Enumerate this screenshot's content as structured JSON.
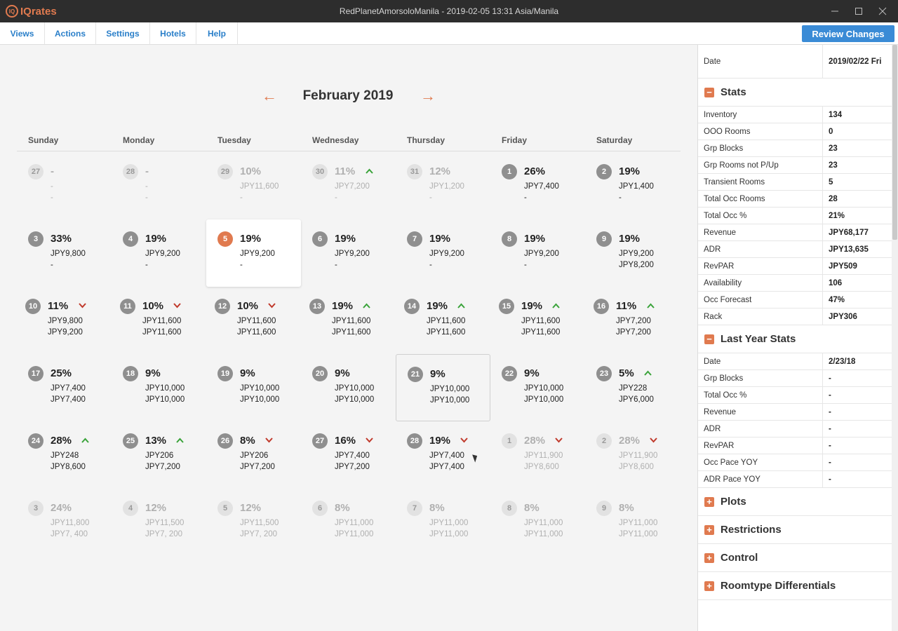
{
  "app": {
    "logo_text": "IQrates",
    "logo_mark": "IQ",
    "window_title": "RedPlanetAmorsoloManila - 2019-02-05 13:31 Asia/Manila"
  },
  "menu": {
    "items": [
      "Views",
      "Actions",
      "Settings",
      "Hotels",
      "Help"
    ],
    "review_label": "Review Changes"
  },
  "calendar": {
    "month": "February 2019",
    "prev_icon": "←",
    "next_icon": "→",
    "weekdays": [
      "Sunday",
      "Monday",
      "Tuesday",
      "Wednesday",
      "Thursday",
      "Friday",
      "Saturday"
    ],
    "weeks": [
      [
        {
          "day": "27",
          "occ": "-",
          "l1": "-",
          "l2": "-",
          "muted": true
        },
        {
          "day": "28",
          "occ": "-",
          "l1": "-",
          "l2": "-",
          "muted": true
        },
        {
          "day": "29",
          "occ": "10%",
          "l1": "JPY11,600",
          "l2": "-",
          "muted": true
        },
        {
          "day": "30",
          "occ": "11%",
          "trend": "up",
          "l1": "JPY7,200",
          "l2": "-",
          "muted": true
        },
        {
          "day": "31",
          "occ": "12%",
          "l1": "JPY1,200",
          "l2": "-",
          "muted": true
        },
        {
          "day": "1",
          "occ": "26%",
          "l1": "JPY7,400",
          "l2": "-"
        },
        {
          "day": "2",
          "occ": "19%",
          "l1": "JPY1,400",
          "l2": "-"
        }
      ],
      [
        {
          "day": "3",
          "occ": "33%",
          "l1": "JPY9,800",
          "l2": "-"
        },
        {
          "day": "4",
          "occ": "19%",
          "l1": "JPY9,200",
          "l2": "-"
        },
        {
          "day": "5",
          "occ": "19%",
          "l1": "JPY9,200",
          "l2": "-",
          "today": true
        },
        {
          "day": "6",
          "occ": "19%",
          "l1": "JPY9,200",
          "l2": "-"
        },
        {
          "day": "7",
          "occ": "19%",
          "l1": "JPY9,200",
          "l2": "-"
        },
        {
          "day": "8",
          "occ": "19%",
          "l1": "JPY9,200",
          "l2": "-"
        },
        {
          "day": "9",
          "occ": "19%",
          "l1": "JPY9,200",
          "l2": "JPY8,200"
        }
      ],
      [
        {
          "day": "10",
          "occ": "11%",
          "trend": "down",
          "l1": "JPY9,800",
          "l2": "JPY9,200"
        },
        {
          "day": "11",
          "occ": "10%",
          "trend": "down",
          "l1": "JPY11,600",
          "l2": "JPY11,600"
        },
        {
          "day": "12",
          "occ": "10%",
          "trend": "down",
          "l1": "JPY11,600",
          "l2": "JPY11,600"
        },
        {
          "day": "13",
          "occ": "19%",
          "trend": "up",
          "l1": "JPY11,600",
          "l2": "JPY11,600"
        },
        {
          "day": "14",
          "occ": "19%",
          "trend": "up",
          "l1": "JPY11,600",
          "l2": "JPY11,600"
        },
        {
          "day": "15",
          "occ": "19%",
          "trend": "up",
          "l1": "JPY11,600",
          "l2": "JPY11,600"
        },
        {
          "day": "16",
          "occ": "11%",
          "trend": "up",
          "l1": "JPY7,200",
          "l2": "JPY7,200"
        }
      ],
      [
        {
          "day": "17",
          "occ": "25%",
          "l1": "JPY7,400",
          "l2": "JPY7,400"
        },
        {
          "day": "18",
          "occ": "9%",
          "l1": "JPY10,000",
          "l2": "JPY10,000"
        },
        {
          "day": "19",
          "occ": "9%",
          "l1": "JPY10,000",
          "l2": "JPY10,000"
        },
        {
          "day": "20",
          "occ": "9%",
          "l1": "JPY10,000",
          "l2": "JPY10,000"
        },
        {
          "day": "21",
          "occ": "9%",
          "l1": "JPY10,000",
          "l2": "JPY10,000",
          "selected": true
        },
        {
          "day": "22",
          "occ": "9%",
          "l1": "JPY10,000",
          "l2": "JPY10,000"
        },
        {
          "day": "23",
          "occ": "5%",
          "trend": "up",
          "l1": "JPY228",
          "l2": "JPY6,000"
        }
      ],
      [
        {
          "day": "24",
          "occ": "28%",
          "trend": "up",
          "l1": "JPY248",
          "l2": "JPY8,600"
        },
        {
          "day": "25",
          "occ": "13%",
          "trend": "up",
          "l1": "JPY206",
          "l2": "JPY7,200"
        },
        {
          "day": "26",
          "occ": "8%",
          "trend": "down",
          "l1": "JPY206",
          "l2": "JPY7,200"
        },
        {
          "day": "27",
          "occ": "16%",
          "trend": "down",
          "l1": "JPY7,400",
          "l2": "JPY7,200"
        },
        {
          "day": "28",
          "occ": "19%",
          "trend": "down",
          "l1": "JPY7,400",
          "l2": "JPY7,400"
        },
        {
          "day": "1",
          "occ": "28%",
          "trend": "down",
          "l1": "JPY11,900",
          "l2": "JPY8,600",
          "muted": true
        },
        {
          "day": "2",
          "occ": "28%",
          "trend": "down",
          "l1": "JPY11,900",
          "l2": "JPY8,600",
          "muted": true
        }
      ],
      [
        {
          "day": "3",
          "occ": "24%",
          "l1": "JPY11,800",
          "l2": "JPY7, 400",
          "muted": true
        },
        {
          "day": "4",
          "occ": "12%",
          "l1": "JPY11,500",
          "l2": "JPY7, 200",
          "muted": true
        },
        {
          "day": "5",
          "occ": "12%",
          "l1": "JPY11,500",
          "l2": "JPY7, 200",
          "muted": true
        },
        {
          "day": "6",
          "occ": "8%",
          "l1": "JPY11,000",
          "l2": "JPY11,000",
          "muted": true
        },
        {
          "day": "7",
          "occ": "8%",
          "l1": "JPY11,000",
          "l2": "JPY11,000",
          "muted": true
        },
        {
          "day": "8",
          "occ": "8%",
          "l1": "JPY11,000",
          "l2": "JPY11,000",
          "muted": true
        },
        {
          "day": "9",
          "occ": "8%",
          "l1": "JPY11,000",
          "l2": "JPY11,000",
          "muted": true
        }
      ]
    ]
  },
  "panel": {
    "date_label": "Date",
    "date_value": "2019/02/22 Fri",
    "stats_title": "Stats",
    "stats": [
      {
        "k": "Inventory",
        "v": "134"
      },
      {
        "k": "OOO Rooms",
        "v": "0"
      },
      {
        "k": "Grp Blocks",
        "v": "23"
      },
      {
        "k": "Grp Rooms not P/Up",
        "v": "23"
      },
      {
        "k": "Transient Rooms",
        "v": "5"
      },
      {
        "k": "Total Occ Rooms",
        "v": "28"
      },
      {
        "k": "Total Occ %",
        "v": "21%"
      },
      {
        "k": "Revenue",
        "v": "JPY68,177"
      },
      {
        "k": "ADR",
        "v": "JPY13,635"
      },
      {
        "k": "RevPAR",
        "v": "JPY509"
      },
      {
        "k": "Availability",
        "v": "106"
      },
      {
        "k": "Occ Forecast",
        "v": "47%"
      },
      {
        "k": "Rack",
        "v": "JPY306"
      }
    ],
    "ly_title": "Last Year Stats",
    "ly_stats": [
      {
        "k": "Date",
        "v": "2/23/18"
      },
      {
        "k": "Grp Blocks",
        "v": "-"
      },
      {
        "k": "Total Occ %",
        "v": "-"
      },
      {
        "k": "Revenue",
        "v": "-"
      },
      {
        "k": "ADR",
        "v": "-"
      },
      {
        "k": "RevPAR",
        "v": "-"
      },
      {
        "k": "Occ Pace YOY",
        "v": "-"
      },
      {
        "k": "ADR Pace YOY",
        "v": "-"
      }
    ],
    "collapsed_sections": [
      "Plots",
      "Restrictions",
      "Control",
      "Roomtype Differentials"
    ],
    "minus_sign": "−",
    "plus_sign": "+"
  },
  "colors": {
    "accent": "#e07a4f",
    "link": "#2a7fc9",
    "button": "#3a8bd6",
    "up": "#3aa33a",
    "down": "#c0392b"
  }
}
